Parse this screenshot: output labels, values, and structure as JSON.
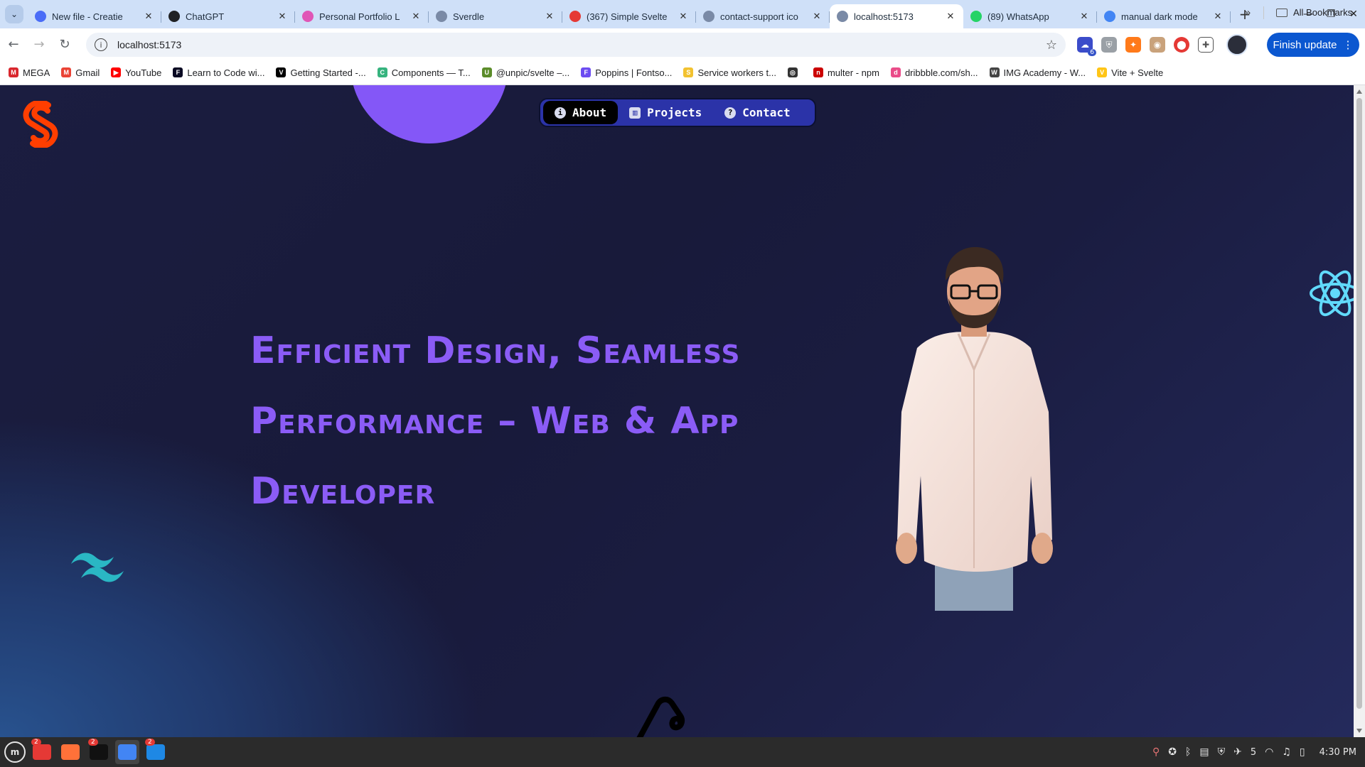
{
  "browser": {
    "tabs": [
      {
        "title": "New file - Creatie",
        "favicon_color": "#4a6cf7",
        "active": false
      },
      {
        "title": "ChatGPT",
        "favicon_color": "#202124",
        "active": false
      },
      {
        "title": "Personal Portfolio L",
        "favicon_color": "#e056b6",
        "active": false
      },
      {
        "title": "Sverdle",
        "favicon_color": "#7a8aa6",
        "active": false
      },
      {
        "title": "(367) Simple Svelte",
        "favicon_color": "#e53935",
        "active": false
      },
      {
        "title": "contact-support ico",
        "favicon_color": "#7a8aa6",
        "active": false
      },
      {
        "title": "localhost:5173",
        "favicon_color": "#7a8aa6",
        "active": true
      },
      {
        "title": "(89) WhatsApp",
        "favicon_color": "#25d366",
        "active": false
      },
      {
        "title": "manual dark mode",
        "favicon_color": "#4285f4",
        "active": false
      }
    ],
    "close_glyph": "✕",
    "new_tab_glyph": "+",
    "url": "localhost:5173",
    "finish_update_label": "Finish update",
    "extension_badge": "6",
    "bookmarks": [
      {
        "label": "MEGA",
        "color": "#d9272e",
        "glyph": "M"
      },
      {
        "label": "Gmail",
        "color": "#ea4335",
        "glyph": "M"
      },
      {
        "label": "YouTube",
        "color": "#ff0000",
        "glyph": "▶"
      },
      {
        "label": "Learn to Code wi...",
        "color": "#0a0a23",
        "glyph": "F"
      },
      {
        "label": "Getting Started -...",
        "color": "#000000",
        "glyph": "V"
      },
      {
        "label": "Components — T...",
        "color": "#36b37e",
        "glyph": "C"
      },
      {
        "label": "@unpic/svelte –...",
        "color": "#5b8c2a",
        "glyph": "U"
      },
      {
        "label": "Poppins | Fontso...",
        "color": "#6c4cf1",
        "glyph": "F"
      },
      {
        "label": "Service workers t...",
        "color": "#f2c230",
        "glyph": "S"
      },
      {
        "label": "",
        "color": "#333333",
        "glyph": "◎"
      },
      {
        "label": "multer - npm",
        "color": "#cb0000",
        "glyph": "n"
      },
      {
        "label": "dribbble.com/sh...",
        "color": "#ea4c89",
        "glyph": "d"
      },
      {
        "label": "IMG Academy - W...",
        "color": "#444444",
        "glyph": "W"
      },
      {
        "label": "Vite + Svelte",
        "color": "#ffc517",
        "glyph": "V"
      }
    ],
    "bookmarks_more_glyph": "»",
    "all_bookmarks_label": "All Bookmarks"
  },
  "page": {
    "nav": {
      "items": [
        {
          "label": "About",
          "icon": "info-icon",
          "glyph": "i",
          "active": true
        },
        {
          "label": "Projects",
          "icon": "board-icon",
          "glyph": "▥",
          "active": false
        },
        {
          "label": "Contact",
          "icon": "question-icon",
          "glyph": "?",
          "active": false
        }
      ]
    },
    "headline_lines": [
      "Efficient Design, Seamless",
      "Performance – Web & App",
      "Developer"
    ],
    "colors": {
      "accent_purple": "#8b5cf6",
      "blob": "#8457f7",
      "nav_bg": "#2b33a8",
      "svelte_orange": "#ff3e00",
      "react_cyan": "#61dafb",
      "tailwind_teal": "#38bdf8"
    },
    "decorations": [
      "svelte-logo-icon",
      "react-logo-icon",
      "tailwind-logo-icon",
      "svelte-outline-icon",
      "developer-portrait"
    ]
  },
  "taskbar": {
    "apps": [
      {
        "name": "files",
        "badge": "2",
        "color": "#e53935"
      },
      {
        "name": "firefox",
        "badge": "",
        "color": "#ff7139"
      },
      {
        "name": "terminal",
        "badge": "2",
        "color": "#111111"
      },
      {
        "name": "chrome",
        "badge": "",
        "color": "#4285f4"
      },
      {
        "name": "vscode",
        "badge": "2",
        "color": "#1e88e5"
      }
    ],
    "tray_count": "5",
    "clock": "4:30 PM"
  }
}
